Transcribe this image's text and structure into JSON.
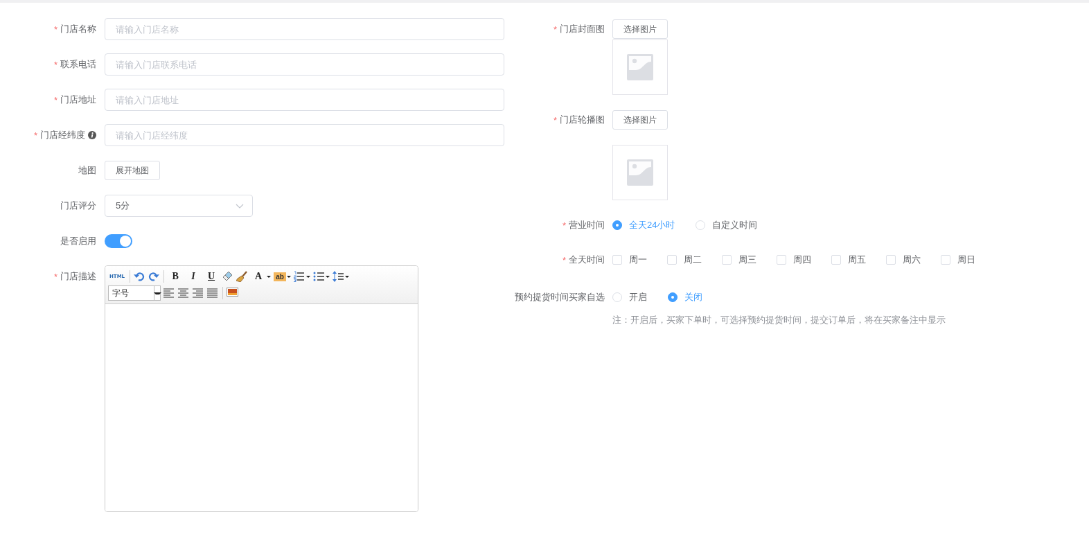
{
  "store_form": {
    "fields": [
      {
        "kind": "text",
        "label": "门店名称",
        "required_mark": "*",
        "help_icon": false,
        "placeholder": "请输入门店名称"
      },
      {
        "kind": "text",
        "label": "联系电话",
        "required_mark": "*",
        "help_icon": false,
        "placeholder": "请输入门店联系电话"
      },
      {
        "kind": "text",
        "label": "门店地址",
        "required_mark": "*",
        "help_icon": false,
        "placeholder": "请输入门店地址"
      },
      {
        "kind": "text",
        "label": "门店经纬度",
        "required_mark": "*",
        "help_icon": true,
        "placeholder": "请输入门店经纬度"
      },
      {
        "kind": "button",
        "label": "地图",
        "button": "展开地图"
      },
      {
        "kind": "select",
        "label": "门店评分",
        "value": "5分"
      },
      {
        "kind": "switch",
        "label": "是否启用",
        "on": true
      },
      {
        "kind": "editor",
        "label": "门店描述",
        "required_mark": "*",
        "toolbar_labels": {
          "html": "HTML",
          "bold": "B",
          "italic": "I",
          "underline": "U",
          "font_color": "A",
          "highlight": "ab"
        },
        "font_size": "字号"
      }
    ]
  },
  "store_settings": {
    "fields": [
      {
        "kind": "image",
        "label": "门店封面图",
        "required_mark": "*",
        "button": "选择图片"
      },
      {
        "kind": "gallery",
        "label": "门店轮播图",
        "required_mark": "*",
        "button": "选择图片"
      },
      {
        "kind": "radio",
        "label": "营业时间",
        "required_mark": "*",
        "options": [
          {
            "label": "全天24小时",
            "selected": true
          },
          {
            "label": "自定义时间",
            "selected": false
          }
        ]
      },
      {
        "kind": "checkbox",
        "label": "全天时间",
        "required_mark": "*",
        "options": [
          {
            "label": "周一",
            "checked": false
          },
          {
            "label": "周二",
            "checked": false
          },
          {
            "label": "周三",
            "checked": false
          },
          {
            "label": "周四",
            "checked": false
          },
          {
            "label": "周五",
            "checked": false
          },
          {
            "label": "周六",
            "checked": false
          },
          {
            "label": "周日",
            "checked": false
          }
        ]
      },
      {
        "kind": "radio",
        "label": "预约提货时间买家自选",
        "options": [
          {
            "label": "开启",
            "selected": false
          },
          {
            "label": "关闭",
            "selected": true
          }
        ],
        "note": "注：开启后，买家下单时，可选择预约提货时间，提交订单后，将在买家备注中显示"
      }
    ]
  }
}
